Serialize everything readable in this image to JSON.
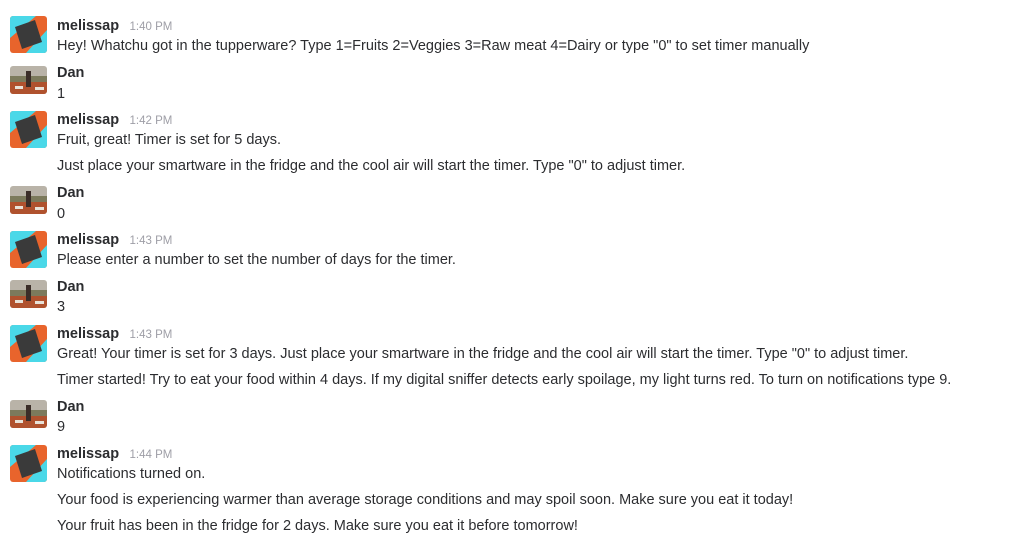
{
  "messages": [
    {
      "sender": "melissap",
      "time": "1:40 PM",
      "lines": [
        "Hey! Whatchu got in the tupperware? Type 1=Fruits 2=Veggies 3=Raw meat 4=Dairy or type \"0\" to set timer manually"
      ]
    },
    {
      "sender": "Dan",
      "time": "",
      "lines": [
        "1"
      ]
    },
    {
      "sender": "melissap",
      "time": "1:42 PM",
      "lines": [
        "Fruit, great! Timer is set for 5 days.",
        "Just place your smartware in the fridge and the cool air will start the timer. Type \"0\" to adjust timer."
      ]
    },
    {
      "sender": "Dan",
      "time": "",
      "lines": [
        "0"
      ]
    },
    {
      "sender": "melissap",
      "time": "1:43 PM",
      "lines": [
        "Please enter a number to set the number of days for the timer."
      ]
    },
    {
      "sender": "Dan",
      "time": "",
      "lines": [
        "3"
      ]
    },
    {
      "sender": "melissap",
      "time": "1:43 PM",
      "lines": [
        "Great! Your timer is set for 3 days. Just place your smartware in the fridge and the cool air will start the timer. Type \"0\" to adjust timer.",
        "Timer started! Try to eat your food within 4 days. If my digital sniffer detects early spoilage, my light turns red. To turn on notifications type 9."
      ]
    },
    {
      "sender": "Dan",
      "time": "",
      "lines": [
        "9"
      ]
    },
    {
      "sender": "melissap",
      "time": "1:44 PM",
      "lines": [
        "Notifications turned on.",
        "Your food is experiencing warmer than average storage conditions and may spoil soon. Make sure you eat it today!",
        "Your fruit has been in the fridge for 2 days. Make sure you eat it before tomorrow!"
      ]
    }
  ],
  "colors": {
    "bot_avatar_orange": "#e8642c",
    "bot_avatar_cyan": "#4ad8e8",
    "bot_avatar_dark": "#3a3a3a",
    "text": "#2c2d30",
    "timestamp": "#9e9ea6"
  }
}
